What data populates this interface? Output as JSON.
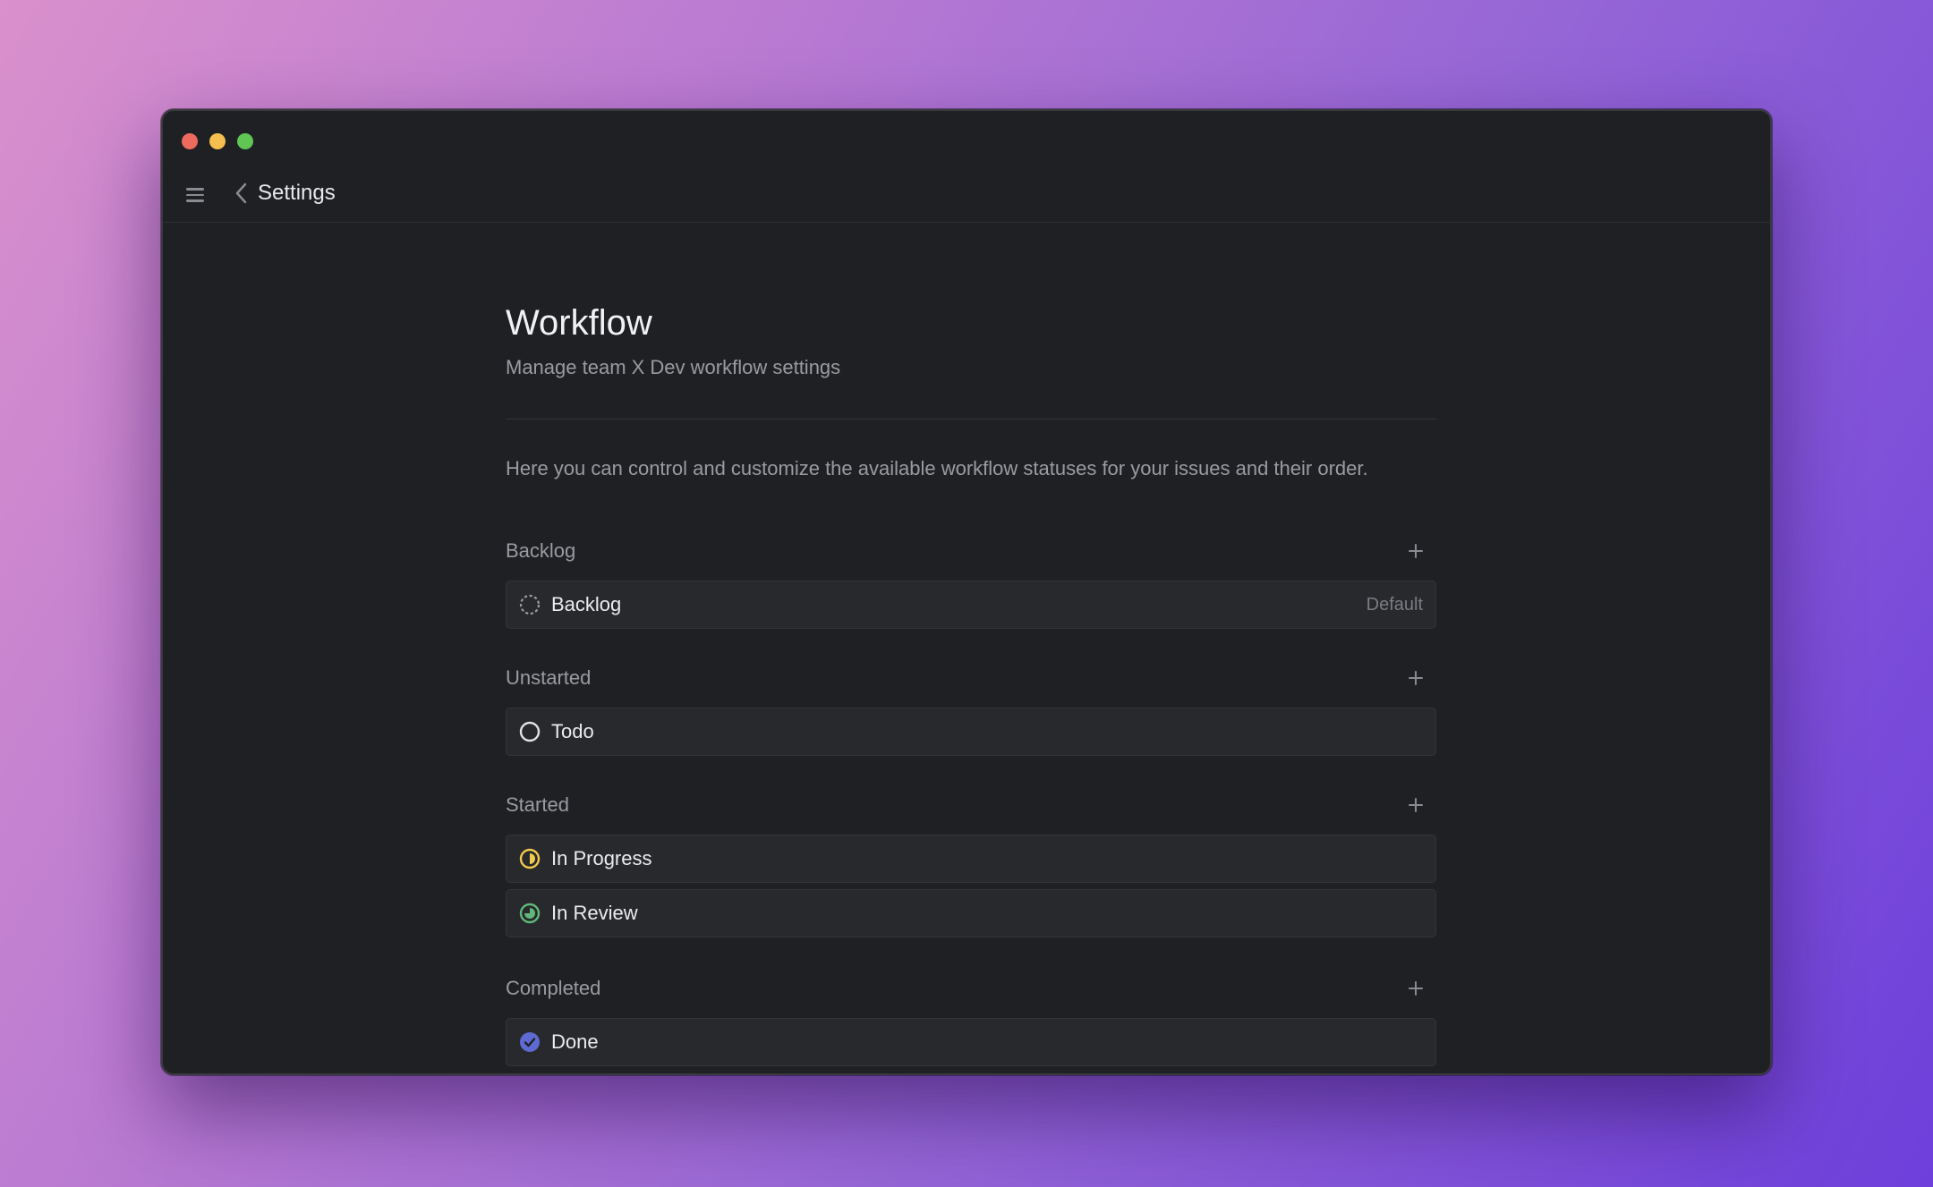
{
  "window": {
    "controls": [
      "close",
      "minimize",
      "maximize"
    ]
  },
  "topbar": {
    "menu_icon": "hamburger-icon",
    "back_icon": "chevron-left-icon",
    "back_label": "Settings"
  },
  "page": {
    "title": "Workflow",
    "subtitle": "Manage team X Dev workflow settings",
    "description": "Here you can control and customize the available workflow statuses for your issues and their order."
  },
  "groups": [
    {
      "label": "Backlog",
      "statuses": [
        {
          "name": "Backlog",
          "icon": "dashed-circle-icon",
          "badge": "Default",
          "color": "#9a9ba1"
        }
      ]
    },
    {
      "label": "Unstarted",
      "statuses": [
        {
          "name": "Todo",
          "icon": "empty-circle-icon",
          "badge": "",
          "color": "#e2e2e5"
        }
      ]
    },
    {
      "label": "Started",
      "statuses": [
        {
          "name": "In Progress",
          "icon": "half-circle-icon",
          "badge": "",
          "color": "#f2c94c"
        },
        {
          "name": "In Review",
          "icon": "three-quarter-circle-icon",
          "badge": "",
          "color": "#5fb87a"
        }
      ]
    },
    {
      "label": "Completed",
      "statuses": [
        {
          "name": "Done",
          "icon": "check-circle-icon",
          "badge": "",
          "color": "#5e6ad2"
        }
      ]
    }
  ],
  "colors": {
    "window_bg": "#1f2023",
    "row_bg": "#28292d",
    "muted_text": "#9a9ba1",
    "text": "#ececef"
  }
}
